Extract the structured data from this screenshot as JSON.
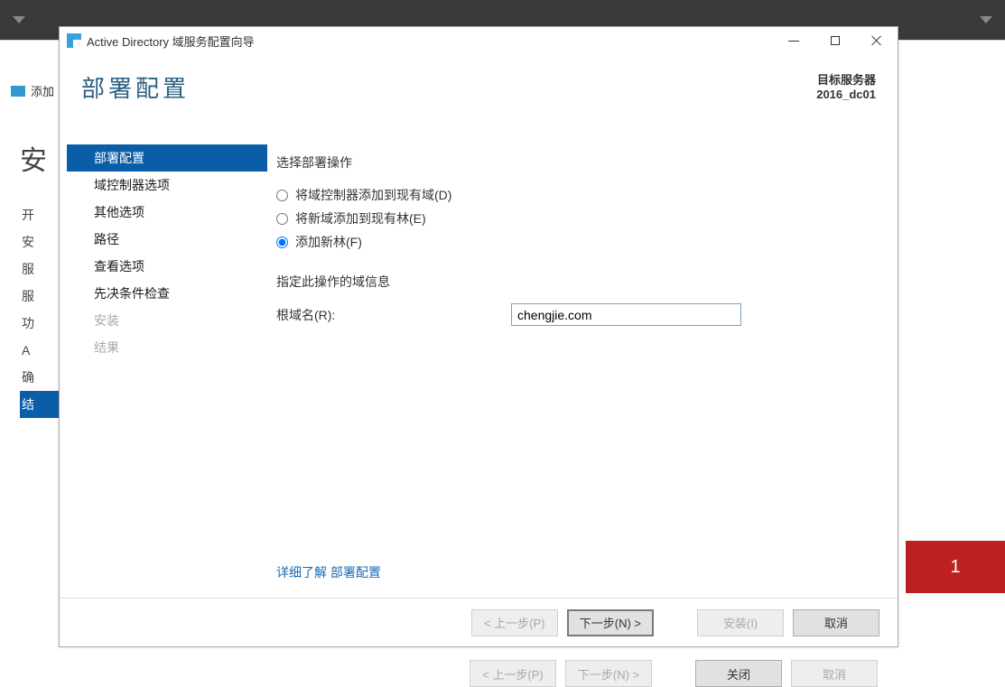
{
  "dialog": {
    "window_title": "Active Directory 域服务配置向导",
    "page_title": "部署配置",
    "target_label": "目标服务器",
    "target_name": "2016_dc01",
    "nav": [
      {
        "label": "部署配置",
        "state": "sel"
      },
      {
        "label": "域控制器选项",
        "state": ""
      },
      {
        "label": "其他选项",
        "state": ""
      },
      {
        "label": "路径",
        "state": ""
      },
      {
        "label": "查看选项",
        "state": ""
      },
      {
        "label": "先决条件检查",
        "state": ""
      },
      {
        "label": "安装",
        "state": "dis"
      },
      {
        "label": "结果",
        "state": "dis"
      }
    ],
    "content": {
      "select_op_label": "选择部署操作",
      "radio_options": [
        {
          "label": "将域控制器添加到现有域(D)",
          "checked": false
        },
        {
          "label": "将新域添加到现有林(E)",
          "checked": false
        },
        {
          "label": "添加新林(F)",
          "checked": true
        }
      ],
      "domain_info_label": "指定此操作的域信息",
      "root_domain_label": "根域名(R):",
      "root_domain_value": "chengjie.com",
      "learn_more": "详细了解 部署配置"
    },
    "footer": {
      "prev": "< 上一步(P)",
      "next": "下一步(N) >",
      "install": "安装(I)",
      "cancel": "取消"
    }
  },
  "bg": {
    "breadcrumb_prefix": "添加",
    "title": "安",
    "sidebar": [
      {
        "label": "开",
        "state": ""
      },
      {
        "label": "安",
        "state": ""
      },
      {
        "label": "服",
        "state": ""
      },
      {
        "label": "服",
        "state": ""
      },
      {
        "label": "功",
        "state": ""
      },
      {
        "label": "A",
        "state": ""
      },
      {
        "label": "确",
        "state": ""
      },
      {
        "label": "结",
        "state": "sel"
      }
    ],
    "red_badge": "1",
    "footer": {
      "prev": "< 上一步(P)",
      "next": "下一步(N) >",
      "close": "关闭",
      "cancel": "取消"
    }
  }
}
